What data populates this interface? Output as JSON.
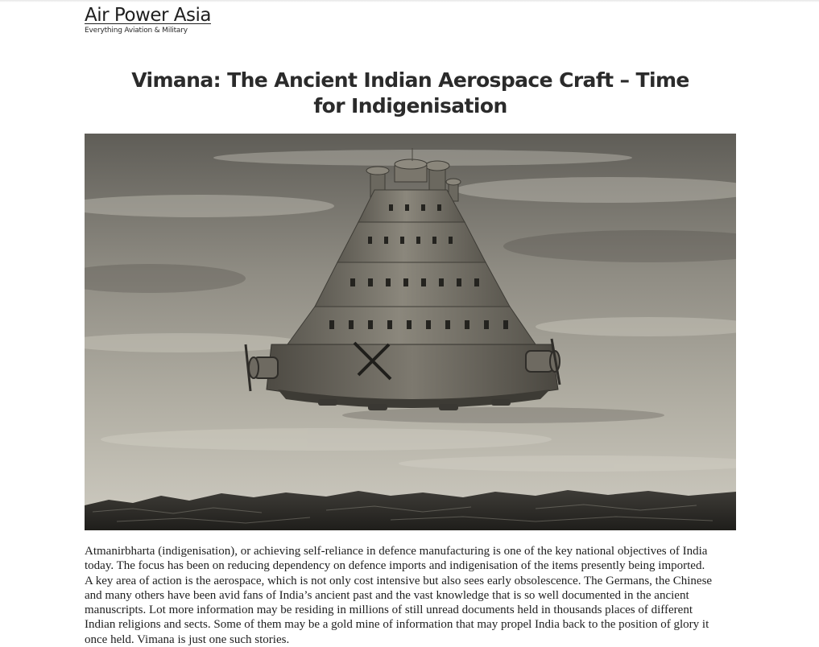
{
  "site": {
    "title": "Air Power Asia",
    "tagline": "Everything Aviation & Military"
  },
  "post": {
    "title_lines": [
      "Vimana: The Ancient Indian Aerospace Craft – Time",
      "for Indigenisation"
    ],
    "image_icon": "vimana-illustration",
    "body_lines": [
      "Atmanirbharta (indigenisation), or achieving self-reliance in defence manufacturing is one of the key national objectives of India",
      "today. The focus has been on reducing dependency on defence imports and indigenisation of the items presently being imported.",
      "A key area of action is the aerospace, which is not only cost intensive but also sees early obsolescence. The Germans, the Chinese",
      "and many others have been avid fans of India’s ancient past and the vast knowledge that is so well documented in the ancient",
      "manuscripts. Lot more information may be residing in millions of still unread documents held in thousands places of different",
      "Indian religions and sects. Some of them may be a gold mine of information that may propel India back to the position of glory it",
      "once held. Vimana is just one such stories."
    ]
  },
  "colors": {
    "text": "#1e1e1e",
    "title": "#2b2b2b",
    "background": "#ffffff"
  }
}
